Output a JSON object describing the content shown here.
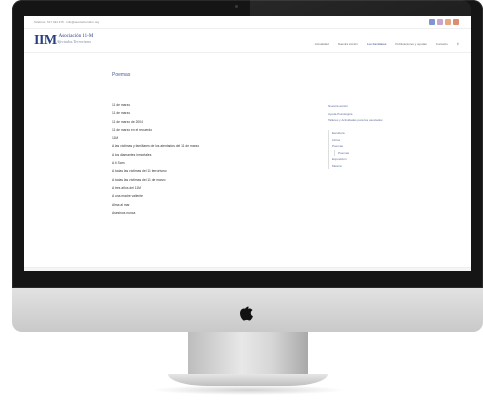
{
  "site": {
    "topbar_text": "Teléfono: 617 434 376 · info@asociacion11m.org",
    "logo_mark": "IIM",
    "logo_title": "Asociación 11-M",
    "logo_subtitle": "Afectados Terrorismo",
    "social_colors": [
      "#7a8fd0",
      "#c9a0c9",
      "#e6a37a",
      "#d9896a"
    ]
  },
  "nav": {
    "items": [
      "Actualidad",
      "Nuestra Acción",
      "Los Familiares",
      "Publicaciones y ayudas",
      "Contacto"
    ],
    "active_index": 2,
    "search_icon": "search-icon"
  },
  "page": {
    "title": "Poemas",
    "items": [
      "11 de marzo",
      "11 de marzo",
      "11 de marzo de 2004",
      "11 de marzo en el recuerdo",
      "11M",
      "A las víctimas y familiares de los atentados del 11 de marzo",
      "A los diamantes inmortales",
      "A tí Sam",
      "A todas las víctimas del 11 terrorismo",
      "A todas las víctimas del 11 de marzo",
      "A tres años del 11M",
      "A una madre valiente",
      "Alma al mar",
      "Asesinos nunca"
    ]
  },
  "sidebar": {
    "items": [
      "Nuestra acción",
      "Ayuda Psicológica",
      "Talleres y Actividades para los asociados"
    ],
    "sub_items": [
      "Escultura",
      "Libros",
      "Poemas"
    ],
    "sub_sub_items": [
      "Poemas"
    ],
    "tail_items": [
      "Exposición",
      "Música"
    ]
  },
  "colors": {
    "brand_blue": "#2a3f7e",
    "frame": "#151515",
    "silver": "#d0d0d0"
  }
}
